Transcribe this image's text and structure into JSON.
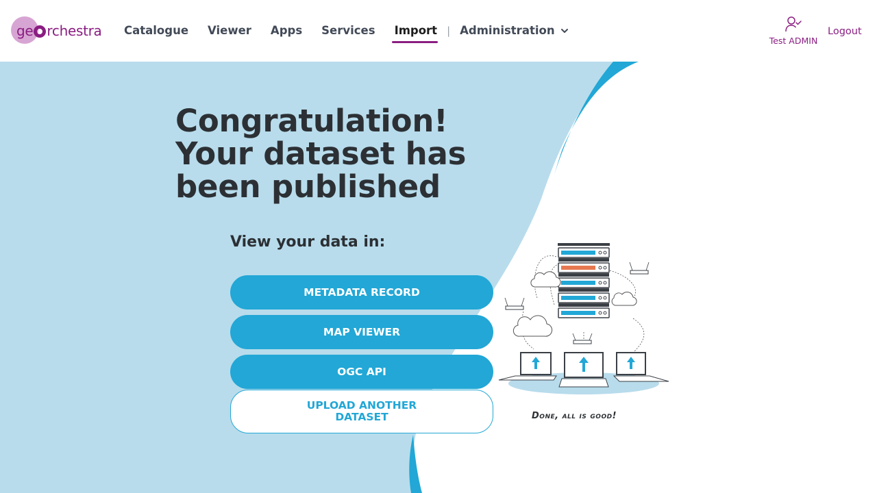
{
  "header": {
    "logo_text_left": "ge",
    "logo_text_right": "rchestra",
    "nav": [
      {
        "label": "Catalogue"
      },
      {
        "label": "Viewer"
      },
      {
        "label": "Apps"
      },
      {
        "label": "Services"
      },
      {
        "label": "Import",
        "active": true
      },
      {
        "label": "Administration"
      }
    ],
    "separator": "|",
    "user_name": "Test ADMIN",
    "logout_label": "Logout"
  },
  "main": {
    "title_lines": [
      "Congratulation!",
      "Your dataset has",
      "been published"
    ],
    "subtitle": "View your data in:",
    "buttons": {
      "metadata": "METADATA RECORD",
      "map_viewer": "MAP VIEWER",
      "ogc_api": "OGC API",
      "upload_line1": "UPLOAD ANOTHER",
      "upload_line2": "DATASET"
    },
    "illustration_caption": "Done, all is good!"
  },
  "colors": {
    "brand": "#8a1d82",
    "accent": "#22a7d6",
    "light_bg": "#b8dcec",
    "text": "#2c3034"
  }
}
